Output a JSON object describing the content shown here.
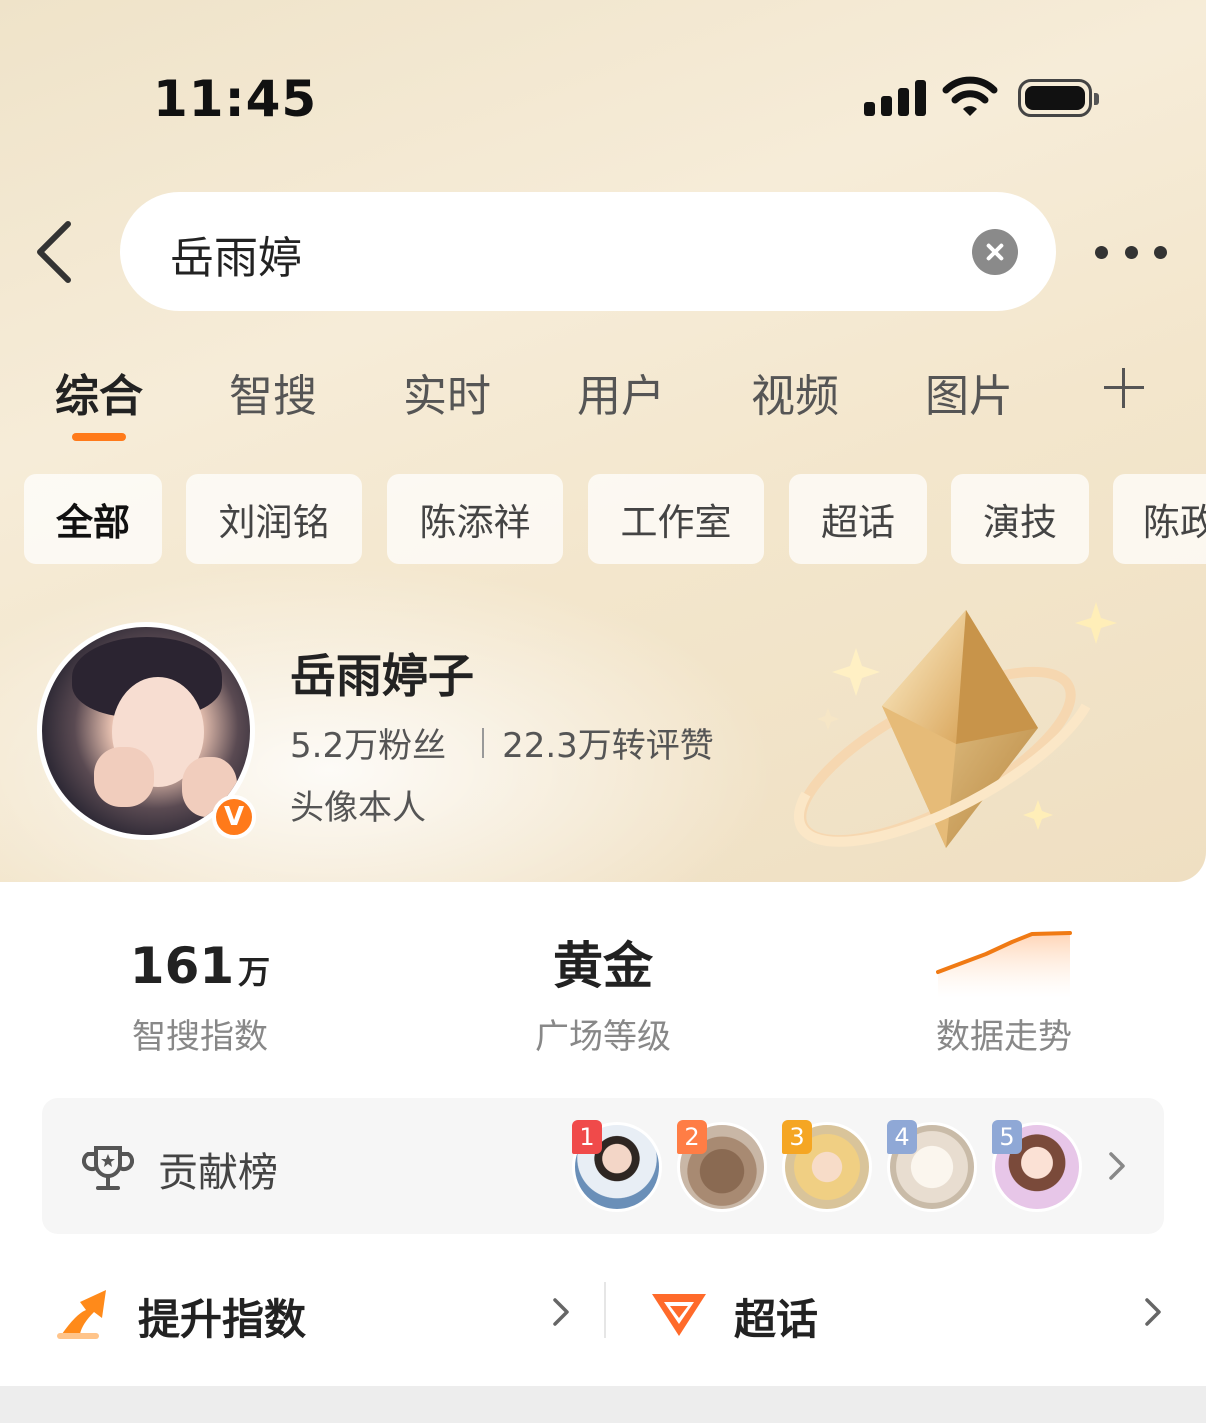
{
  "status_bar": {
    "time": "11:45"
  },
  "search": {
    "query": "岳雨婷"
  },
  "tabs": [
    {
      "label": "综合",
      "active": true
    },
    {
      "label": "智搜"
    },
    {
      "label": "实时"
    },
    {
      "label": "用户"
    },
    {
      "label": "视频"
    },
    {
      "label": "图片"
    }
  ],
  "chips": [
    {
      "label": "全部",
      "active": true
    },
    {
      "label": "刘润铭"
    },
    {
      "label": "陈添祥"
    },
    {
      "label": "工作室"
    },
    {
      "label": "超话"
    },
    {
      "label": "演技"
    },
    {
      "label": "陈政"
    }
  ],
  "profile": {
    "name": "岳雨婷子",
    "fans": "5.2万粉丝",
    "engagement": "22.3万转评赞",
    "desc": "头像本人",
    "verified_badge": "V"
  },
  "metrics": {
    "index_value": "161",
    "index_unit": "万",
    "index_label": "智搜指数",
    "level_value": "黄金",
    "level_label": "广场等级",
    "trend_label": "数据走势"
  },
  "contribution": {
    "label": "贡献榜",
    "ranks": [
      "1",
      "2",
      "3",
      "4",
      "5"
    ]
  },
  "actions": {
    "boost_label": "提升指数",
    "topic_label": "超话"
  },
  "colors": {
    "accent": "#ff7a1a",
    "rank1": "#f04a4a",
    "rank2": "#ff7d45",
    "rank3": "#f5a623",
    "rank_other": "#8fa8d6"
  }
}
